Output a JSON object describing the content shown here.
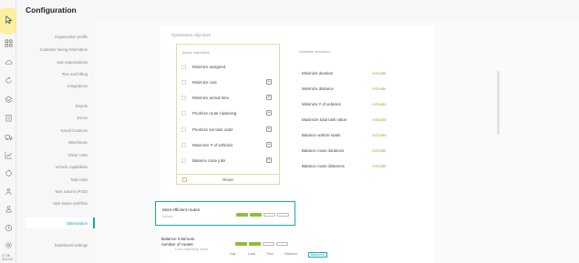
{
  "header": {
    "title": "Configuration"
  },
  "rail": {
    "icons": [
      "cursor-icon",
      "grid-icon",
      "cloud-icon",
      "refresh-icon",
      "layers-icon",
      "clipboard-icon",
      "truck-icon",
      "list-icon",
      "chart-icon",
      "cycle-icon",
      "people-icon",
      "user-icon",
      "clock-icon",
      "gear-icon"
    ],
    "footer_time": "17:28",
    "footer_date": "31/1/23"
  },
  "subnav": {
    "items": [
      {
        "label": "Organization profile"
      },
      {
        "label": "Customer facing information"
      },
      {
        "label": "Sub-organizations"
      },
      {
        "label": "Plan and billing"
      },
      {
        "label": "Integrations"
      },
      {
        "label": "Depots"
      },
      {
        "label": "Zones"
      },
      {
        "label": "Saved locations"
      },
      {
        "label": "Warehouse"
      },
      {
        "label": "Driver roles"
      },
      {
        "label": "Vehicle capabilities"
      },
      {
        "label": "Task roles"
      },
      {
        "label": "Task actions (POD)"
      },
      {
        "label": "Task status workflow"
      },
      {
        "label": "Optimization"
      },
      {
        "label": "Dashboard settings"
      }
    ],
    "active_index": 14
  },
  "main": {
    "section_title": "Optimization objectives",
    "active_header": "Active objectives",
    "available_header": "Available directions",
    "active_objectives": [
      {
        "label": "Minimize assigned"
      },
      {
        "label": "Minimize cost"
      },
      {
        "label": "Minimize arrival time"
      },
      {
        "label": "Prioritize route clustering"
      },
      {
        "label": "Prioritize set task order"
      },
      {
        "label": "Maximize # of vehicles"
      },
      {
        "label": "Balance route jobs"
      }
    ],
    "reset_label": "Reset",
    "available": [
      {
        "label": "Minimize duration",
        "action": "Activate"
      },
      {
        "label": "Minimize distance",
        "action": "Activate"
      },
      {
        "label": "Minimize # of vehicles",
        "action": "Activate"
      },
      {
        "label": "Maximize total task value",
        "action": "Activate"
      },
      {
        "label": "Balance vehicle loads",
        "action": "Activate"
      },
      {
        "label": "Balance route durations",
        "action": "Activate"
      },
      {
        "label": "Balance route distances",
        "action": "Activate"
      }
    ],
    "card1": {
      "title": "Most efficient routes",
      "subtitle": "Default"
    },
    "card2": {
      "title_line1": "Balance minimum",
      "title_line2": "number of routes"
    },
    "lower_label": "Load balancing mode",
    "tabs": [
      "Day",
      "Load",
      "Time",
      "Distance",
      "Balanced"
    ],
    "colors": {
      "accent": "#1aa6b7",
      "activate": "#8bbf3a",
      "border_gold": "#e6d8a6"
    }
  }
}
